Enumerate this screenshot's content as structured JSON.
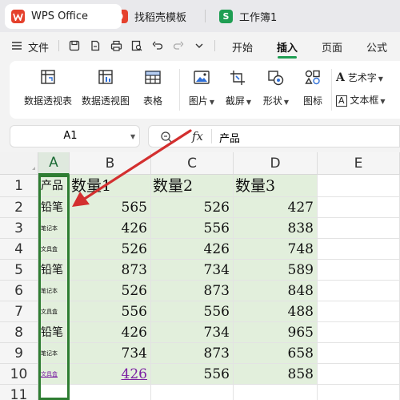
{
  "tabs": [
    {
      "label": "WPS Office",
      "icon": "wps-logo-icon",
      "color": "#e5412d"
    },
    {
      "label": "找稻壳模板",
      "icon": "docer-icon",
      "color": "#e5412d"
    },
    {
      "label": "工作簿1",
      "icon": "sheet-icon",
      "icon_text": "S",
      "color": "#1f9e53"
    }
  ],
  "menu": {
    "file_label": "文件",
    "items": [
      "开始",
      "插入",
      "页面",
      "公式"
    ],
    "active": "插入"
  },
  "ribbon": {
    "buttons": [
      {
        "label": "数据透视表",
        "icon": "pivot-table-icon"
      },
      {
        "label": "数据透视图",
        "icon": "pivot-chart-icon"
      },
      {
        "label": "表格",
        "icon": "table-icon"
      },
      {
        "label": "图片",
        "icon": "picture-icon"
      },
      {
        "label": "截屏",
        "icon": "screenshot-icon"
      },
      {
        "label": "形状",
        "icon": "shape-icon"
      },
      {
        "label": "图标",
        "icon": "icons-icon"
      }
    ],
    "wordart_label": "艺术字",
    "textbox_label": "文本框"
  },
  "formula_bar": {
    "name_box": "A1",
    "fx": "fx",
    "content": "产品"
  },
  "sheet": {
    "columns": [
      "A",
      "B",
      "C",
      "D",
      "E"
    ],
    "rows": [
      "1",
      "2",
      "3",
      "4",
      "5",
      "6",
      "7",
      "8",
      "9",
      "10",
      "11"
    ],
    "header_row": [
      "产品",
      "数量1",
      "数量2",
      "数量3"
    ],
    "col_a": [
      "铅笔",
      "笔记本",
      "文具盒",
      "铅笔",
      "笔记本",
      "文具盒",
      "铅笔",
      "笔记本",
      "文具盒"
    ],
    "values": [
      [
        565,
        526,
        427
      ],
      [
        426,
        556,
        838
      ],
      [
        526,
        426,
        748
      ],
      [
        873,
        734,
        589
      ],
      [
        526,
        873,
        848
      ],
      [
        556,
        556,
        488
      ],
      [
        426,
        734,
        965
      ],
      [
        734,
        873,
        658
      ],
      [
        426,
        556,
        858
      ]
    ]
  },
  "colors": {
    "accent": "#1f9e53",
    "selection": "#2e7d32",
    "fill": "#e2efdc",
    "arrow": "#d32f2f"
  }
}
